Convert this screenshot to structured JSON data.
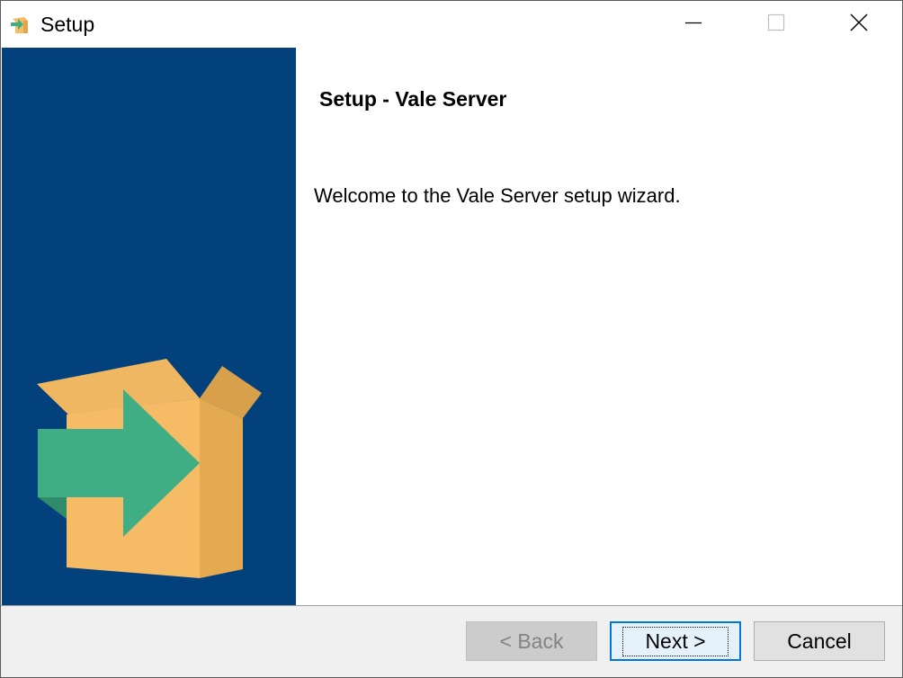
{
  "window": {
    "title": "Setup",
    "controls": {
      "minimize": "minimize",
      "maximize": "maximize",
      "close": "close"
    }
  },
  "sidebar": {
    "background": "#03417c",
    "image": "box-arrow-installer"
  },
  "content": {
    "heading": "Setup - Vale Server",
    "welcome": "Welcome to the Vale Server setup wizard."
  },
  "footer": {
    "back_label": "< Back",
    "next_label": "Next >",
    "cancel_label": "Cancel"
  },
  "colors": {
    "sidebar": "#03417c",
    "box": "#f5bc65",
    "arrow": "#3fae85",
    "focus": "#0078d7"
  }
}
